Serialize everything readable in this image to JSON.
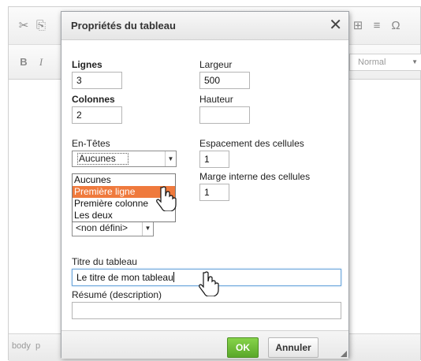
{
  "editor": {
    "toolbar1_icons": [
      "cut-icon",
      "copy-icon",
      "table-icon",
      "horizontal-rule-icon",
      "special-char-icon"
    ],
    "toolbar1_glyphs": {
      "cut": "✂",
      "copy": "⎘",
      "table": "⊞",
      "hr": "≡",
      "omega": "Ω"
    },
    "bold_label": "B",
    "italic_label": "I",
    "format_value": "Normal",
    "status_path": "body  p"
  },
  "dialog": {
    "title": "Propriétés du tableau",
    "close_glyph": "✕",
    "rows": {
      "label": "Lignes",
      "value": "3"
    },
    "cols": {
      "label": "Colonnes",
      "value": "2"
    },
    "width": {
      "label": "Largeur",
      "value": "500"
    },
    "height": {
      "label": "Hauteur",
      "value": ""
    },
    "headers": {
      "label": "En-Têtes",
      "selected": "Aucunes",
      "options": [
        "Aucunes",
        "Première ligne",
        "Première colonne",
        "Les deux"
      ],
      "highlighted_index": 1
    },
    "cell_spacing": {
      "label": "Espacement des cellules",
      "value": "1"
    },
    "cell_padding": {
      "label": "Marge interne des cellules",
      "value": "1"
    },
    "align_select": {
      "value": "<non défini>"
    },
    "caption": {
      "label": "Titre du tableau",
      "value": "Le titre de mon tableau"
    },
    "summary": {
      "label": "Résumé (description)",
      "value": ""
    },
    "ok_label": "OK",
    "cancel_label": "Annuler"
  },
  "colors": {
    "ok_button": "#5aa82a",
    "highlight": "#ef7a3d",
    "focus_border": "#6fa8dc"
  }
}
